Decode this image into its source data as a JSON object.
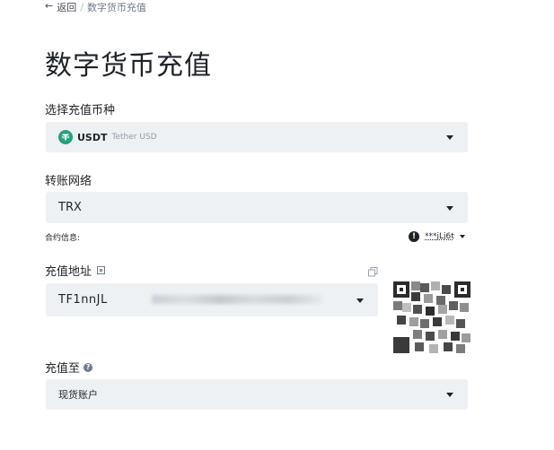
{
  "breadcrumb": {
    "back_arrow": "←",
    "back_label": "返回",
    "separator": "/",
    "current": "数字货币充值"
  },
  "page": {
    "title": "数字货币充值"
  },
  "coin_select": {
    "label": "选择充值币种",
    "code": "USDT",
    "name": "Tether USD",
    "icon": "tether-icon",
    "icon_color": "#26a17b"
  },
  "network_select": {
    "label": "转账网络",
    "value": "TRX"
  },
  "contract": {
    "label": "合约信息:",
    "value": "***jLj6t"
  },
  "address": {
    "label": "充值地址",
    "value": "TF1nnJL"
  },
  "deposit_to": {
    "label": "充值至",
    "value": "现货账户"
  },
  "colors": {
    "field_bg": "#eef1f4",
    "text": "#1e2329",
    "muted": "#707a8a"
  }
}
